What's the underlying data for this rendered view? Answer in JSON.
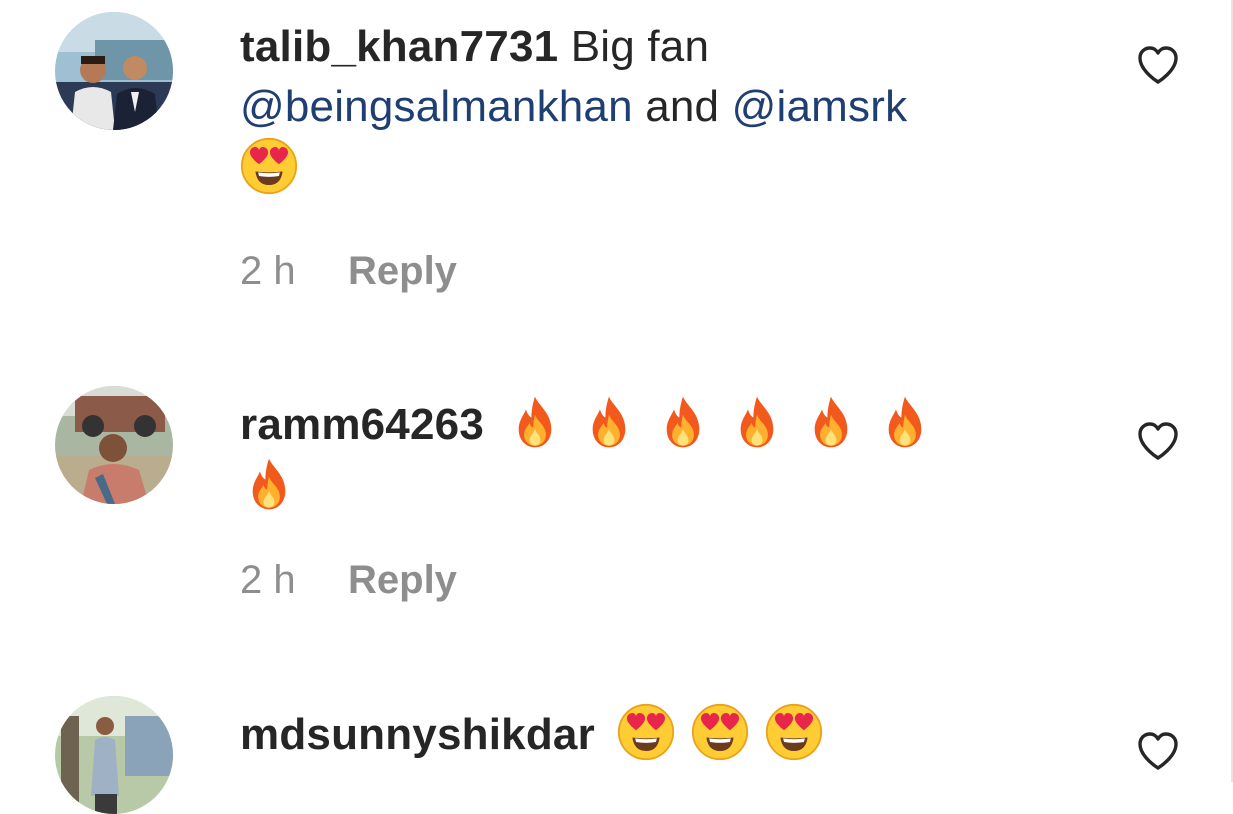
{
  "comments": [
    {
      "username": "talib_khan7731",
      "text": "Big fan",
      "mention_1": "@beingsalmankhan",
      "joiner": "and",
      "mention_2": "@iamsrk",
      "emoji": [
        "heart-eyes"
      ],
      "time": "2 h",
      "reply_label": "Reply",
      "like_icon": "heart-outline-icon"
    },
    {
      "username": "ramm64263",
      "emoji": [
        "fire",
        "fire",
        "fire",
        "fire",
        "fire",
        "fire",
        "fire"
      ],
      "time": "2 h",
      "reply_label": "Reply",
      "like_icon": "heart-outline-icon"
    },
    {
      "username": "mdsunnyshikdar",
      "emoji": [
        "heart-eyes",
        "heart-eyes",
        "heart-eyes"
      ],
      "like_icon": "heart-outline-icon"
    }
  ],
  "colors": {
    "text": "#262626",
    "mention": "#1f3f73",
    "secondary": "#8e8e8e"
  }
}
